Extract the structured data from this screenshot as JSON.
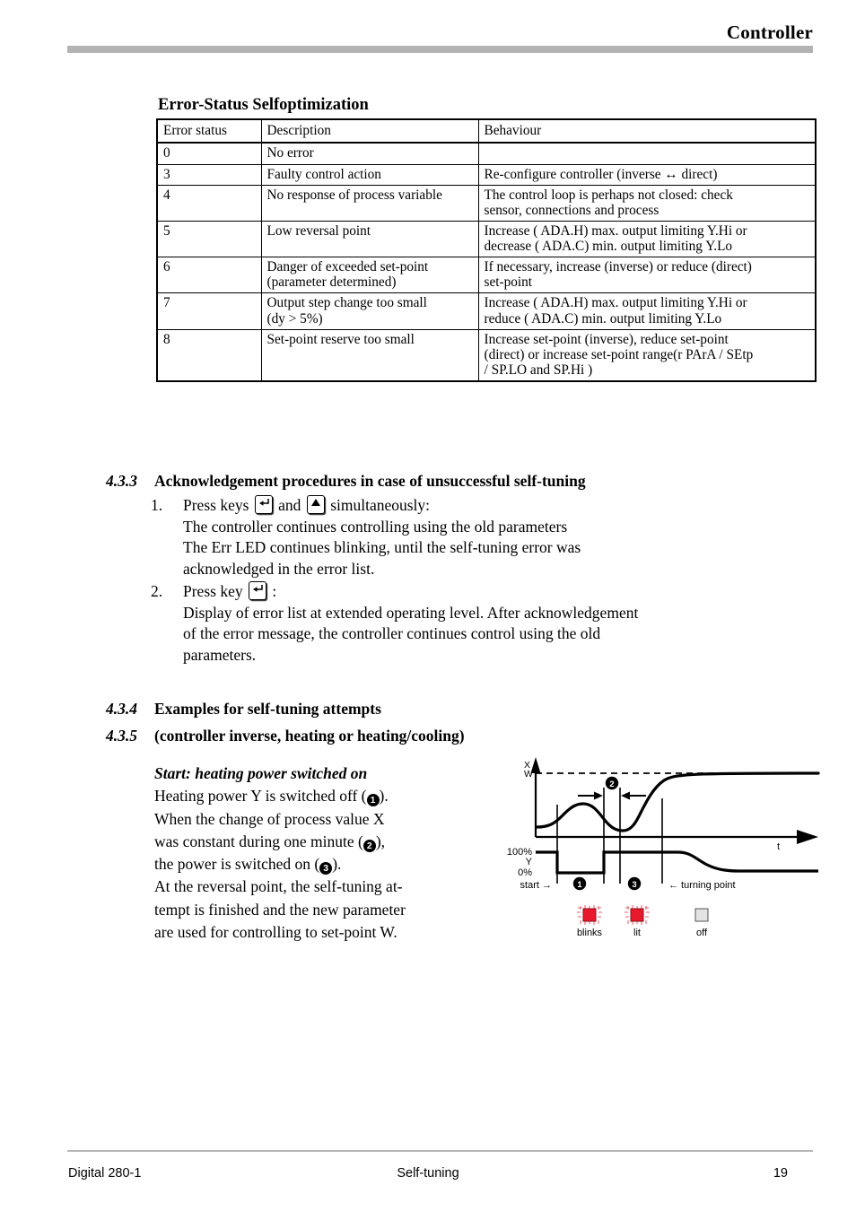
{
  "header": {
    "title": "Controller"
  },
  "table_section": {
    "caption": "Error-Status Selfoptimization",
    "columns": [
      "Error status",
      "Description",
      "Behaviour"
    ],
    "rows": [
      {
        "status": "0",
        "description": [
          "No error"
        ],
        "behaviour": [
          ""
        ]
      },
      {
        "status": "3",
        "description": [
          "Faulty control action"
        ],
        "behaviour": [
          "Re-configure controller (inverse ↔ direct)"
        ]
      },
      {
        "status": "4",
        "description": [
          "No response of process variable"
        ],
        "behaviour": [
          "The control loop is perhaps not closed: check",
          "sensor, connections and process"
        ]
      },
      {
        "status": "5",
        "description": [
          "Low reversal point"
        ],
        "behaviour": [
          "Increase ( ADA.H) max. output  limiting  Y.Hi  or",
          "decrease ( ADA.C) min. output limiting Y.Lo"
        ]
      },
      {
        "status": "6",
        "description": [
          "Danger of exceeded set-point",
          "(parameter determined)"
        ],
        "behaviour": [
          "If necessary, increase (inverse) or reduce (direct)",
          "set-point"
        ]
      },
      {
        "status": "7",
        "description": [
          "Output step change too small",
          "(dy > 5%)"
        ],
        "behaviour": [
          "Increase ( ADA.H) max. output limiting  Y.Hi  or",
          "reduce ( ADA.C) min. output limiting  Y.Lo"
        ]
      },
      {
        "status": "8",
        "description": [
          "Set-point reserve too small"
        ],
        "behaviour": [
          "Increase set-point (inverse), reduce set-point",
          "(direct) or increase set-point range(r PArA / SEtp",
          "/ SP.LO and  SP.Hi )"
        ]
      }
    ]
  },
  "sections": {
    "s433": {
      "number": "4.3.3",
      "title": "Acknowledgement procedures in case of unsuccessful self-tuning"
    },
    "s434": {
      "number": "4.3.4",
      "title": "Examples for self-tuning attempts"
    },
    "s435": {
      "number": "4.3.5",
      "title": "(controller inverse, heating or heating/cooling)"
    }
  },
  "procedure": {
    "items": [
      {
        "marker": "1.",
        "lead": "Press keys",
        "key1": "enter-key",
        "conjunction": "and",
        "key2": "up-arrow-key",
        "trail": "simultaneously:",
        "lines": [
          "The controller continues controlling using the old parameters",
          "The Err LED continues blinking, until the self-tuning error was",
          "acknowledged in the error list."
        ]
      },
      {
        "marker": "2.",
        "lead": "Press key",
        "key1": "enter-key",
        "trail": ":",
        "lines": [
          "Display of error list at extended operating level. After acknowledgement",
          "of the error message, the controller continues control using the old",
          "parameters."
        ]
      }
    ]
  },
  "example": {
    "title": "Start: heating power switched on",
    "lines": [
      {
        "pre": "Heating power Y is switched off (",
        "num": "1",
        "post": ")."
      },
      {
        "pre": "When the change of process value X",
        "num": "",
        "post": ""
      },
      {
        "pre": "was constant during one minute (",
        "num": "2",
        "post": "),"
      },
      {
        "pre": "the power is switched on (",
        "num": "3",
        "post": ")."
      },
      {
        "pre": "At the reversal point, the self-tuning at-",
        "num": "",
        "post": ""
      },
      {
        "pre": "tempt is finished and the new parameter",
        "num": "",
        "post": ""
      },
      {
        "pre": "are used for controlling to  set-point W.",
        "num": "",
        "post": ""
      }
    ]
  },
  "diagram": {
    "axis_x_label": "X",
    "axis_w_label": "W",
    "axis_t_label": "t",
    "y_top_label": "100%",
    "y_mid_label": "Y",
    "y_bottom_label": "0%",
    "start_label": "start →",
    "turning_point_label": "← turning point",
    "phase1_marker": "1",
    "phase2_marker": "2",
    "phase3_marker": "3",
    "legend": [
      {
        "label": "blinks",
        "state": "red-blinking-led",
        "color": "#e8192c"
      },
      {
        "label": "lit",
        "state": "red-lit-led",
        "color": "#e8192c"
      },
      {
        "label": "off",
        "state": "off-led",
        "color": "#e3e3e3"
      }
    ]
  },
  "footer": {
    "left": "Digital 280-1",
    "center": "Self-tuning",
    "right": "19"
  }
}
